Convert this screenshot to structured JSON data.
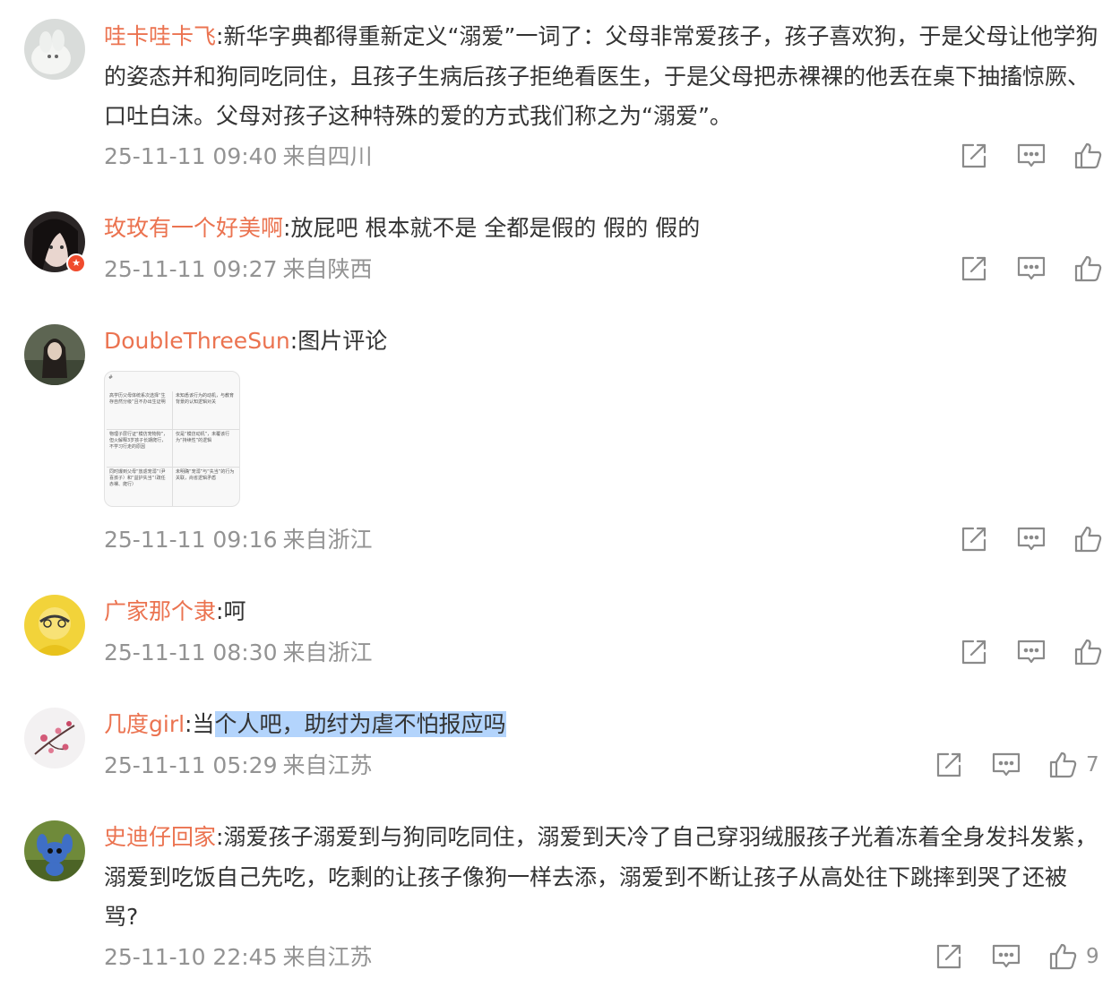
{
  "comments": [
    {
      "username": "哇卡哇卡飞",
      "text": "新华字典都得重新定义“溺爱”一词了：父母非常爱孩子，孩子喜欢狗，于是父母让他学狗的姿态并和狗同吃同住，且孩子生病后孩子拒绝看医生，于是父母把赤裸裸的他丢在桌下抽搐惊厥、口吐白沫。父母对孩子这种特殊的爱的方式我们称之为“溺爱”。",
      "time": "25-11-11 09:40",
      "location": "来自四川",
      "likes": ""
    },
    {
      "username": "玫玫有一个好美啊",
      "text": "放屁吧 根本就不是 全都是假的 假的 假的",
      "time": "25-11-11 09:27",
      "location": "来自陕西",
      "likes": ""
    },
    {
      "username": "DoubleThreeSun",
      "text": "图片评论",
      "time": "25-11-11 09:16",
      "location": "来自浙江",
      "likes": "",
      "thumbnail": {
        "cells": [
          "高学历父母体统系次选择“生存自然分级”且不办出生证明",
          "未知悉该行为的动机，与教育背景的认知逻辑对关",
          "物理子层行证“模仿宠物狗”，但火解释3岁孩子长期爬行，不学习行走的原因",
          "仅是“模仿动机”，未覆该行为“持续性”的逻辑",
          "同时爆到父母“放虐宠溺”（尹喜孩子）和“益护失当”（疏任赤裸、爬行）",
          "未明确“宠溺”与“失当”的行为关联，尚省逻辑矛盾"
        ]
      }
    },
    {
      "username": "广家那个隶",
      "text": "呵",
      "time": "25-11-11 08:30",
      "location": "来自浙江",
      "likes": ""
    },
    {
      "username": "几度girl",
      "text_plain": "当",
      "text_highlight": "个人吧，助纣为虐不怕报应吗",
      "time": "25-11-11 05:29",
      "location": "来自江苏",
      "likes": "7"
    },
    {
      "username": "史迪仔回家",
      "text": "溺爱孩子溺爱到与狗同吃同住，溺爱到天冷了自己穿羽绒服孩子光着冻着全身发抖发紫，溺爱到吃饭自己先吃，吃剩的让孩子像狗一样去添，溺爱到不断让孩子从高处往下跳摔到哭了还被骂?",
      "time": "25-11-10 22:45",
      "location": "来自江苏",
      "likes": "9"
    }
  ],
  "icons": {
    "share": "share-icon",
    "comment": "comment-icon",
    "like": "like-icon"
  },
  "colors": {
    "username": "#eb7350",
    "meta": "#939393",
    "text": "#333333",
    "highlight": "#b3d4fc",
    "vip_badge": "#f04b2d"
  }
}
